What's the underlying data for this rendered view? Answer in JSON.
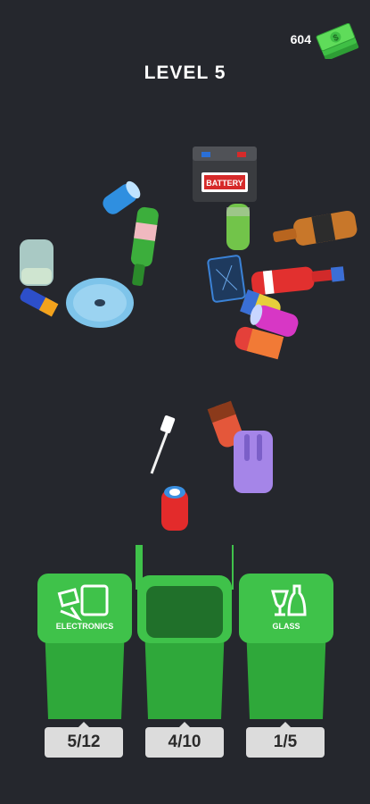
{
  "hud": {
    "money": "604",
    "level_title": "LEVEL 5"
  },
  "items": {
    "battery_label": "BATTERY"
  },
  "bins": [
    {
      "label": "ELECTRONICS",
      "counter": "5/12"
    },
    {
      "label": "",
      "counter": "4/10"
    },
    {
      "label": "GLASS",
      "counter": "1/5"
    }
  ],
  "colors": {
    "background": "#25272d",
    "bin_green": "#2fa83a",
    "counter_bg": "#dcdcdc"
  },
  "icons": [
    "money-stack-icon",
    "electronics-icon",
    "glass-icon"
  ]
}
